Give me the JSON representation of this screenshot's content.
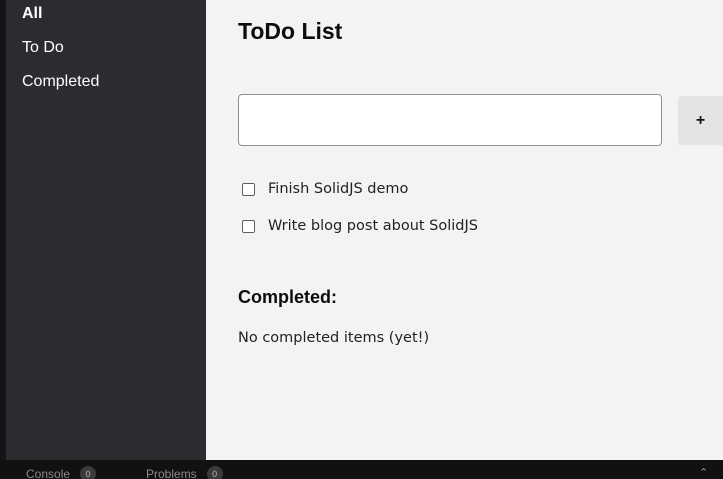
{
  "sidebar": {
    "items": [
      {
        "label": "All",
        "active": true
      },
      {
        "label": "To Do",
        "active": false
      },
      {
        "label": "Completed",
        "active": false
      }
    ]
  },
  "main": {
    "title": "ToDo List",
    "new_todo": {
      "value": "",
      "placeholder": ""
    },
    "add_button_label": "+",
    "todos": [
      {
        "text": "Finish SolidJS demo",
        "checked": false
      },
      {
        "text": "Write blog post about SolidJS",
        "checked": false
      }
    ],
    "completed": {
      "heading": "Completed:",
      "empty_text": "No completed items (yet!)"
    }
  },
  "bottom_panel": {
    "tabs": [
      {
        "label": "Console",
        "count": "0"
      },
      {
        "label": "Problems",
        "count": "0"
      }
    ],
    "toggle_icon": "chevron-up-icon"
  },
  "colors": {
    "sidebar_bg": "#2a2c30",
    "main_bg": "#f3f3f3",
    "panel_bg": "#111111"
  }
}
